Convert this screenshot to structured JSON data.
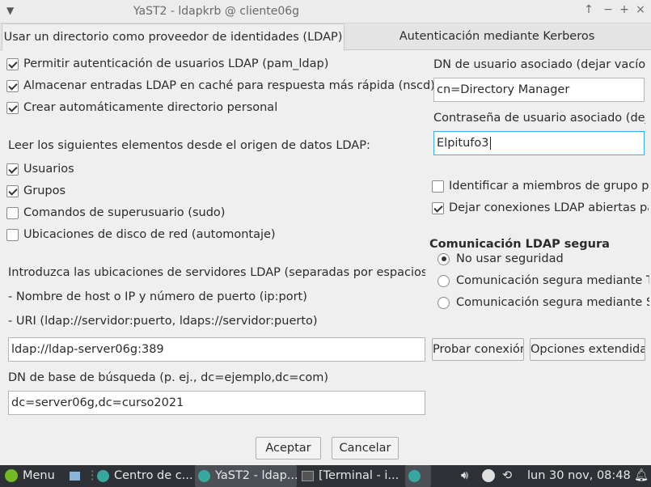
{
  "window": {
    "title": "YaST2 - ldapkrb @ cliente06g",
    "controls": [
      "↑",
      "−",
      "+",
      "×"
    ]
  },
  "tabs": [
    {
      "label": "Usar un directorio como proveedor de identidades (LDAP)"
    },
    {
      "label": "Autenticación mediante Kerberos"
    }
  ],
  "left": {
    "options": [
      {
        "label": "Permitir autenticación de usuarios LDAP (pam_ldap)",
        "checked": true
      },
      {
        "label": "Almacenar entradas LDAP en caché para respuesta más rápida (nscd)",
        "checked": true
      },
      {
        "label": "Crear automáticamente directorio personal",
        "checked": true
      }
    ],
    "read_heading": "Leer los siguientes elementos desde el origen de datos LDAP:",
    "sources": [
      {
        "label": "Usuarios",
        "checked": true
      },
      {
        "label": "Grupos",
        "checked": true
      },
      {
        "label": "Comandos de superusuario (sudo)",
        "checked": false
      },
      {
        "label": "Ubicaciones de disco de red (automontaje)",
        "checked": false
      }
    ],
    "servers_intro": "Introduzca las ubicaciones de servidores LDAP (separadas por espacios) e",
    "hint_host": "- Nombre de host o IP y número de puerto (ip:port)",
    "hint_uri": "- URI (ldap://servidor:puerto, ldaps://servidor:puerto)",
    "server_value": "ldap://ldap-server06g:389",
    "base_dn_label": "DN de base de búsqueda (p. ej., dc=ejemplo,dc=com)",
    "base_dn_value": "dc=server06g,dc=curso2021"
  },
  "right": {
    "bind_dn_label": "DN de usuario asociado (dejar vacío p",
    "bind_dn_value": "cn=Directory Manager",
    "bind_pw_label": "Contraseña de usuario asociado (deja",
    "bind_pw_value": "Elpitufo3",
    "group_members": {
      "label": "Identificar a miembros de grupo po",
      "checked": false
    },
    "keep_open": {
      "label": "Dejar conexiones LDAP abiertas pa",
      "checked": true
    },
    "secure_heading": "Comunicación LDAP segura",
    "security": [
      {
        "label": "No usar seguridad",
        "checked": true
      },
      {
        "label": "Comunicación segura mediante TL",
        "checked": false
      },
      {
        "label": "Comunicación segura mediante St",
        "checked": false
      }
    ],
    "test_button": "Probar conexión",
    "extended_button": "Opciones extendidas"
  },
  "footer": {
    "accept": "Aceptar",
    "cancel": "Cancelar"
  },
  "taskbar": {
    "menu": "Menu",
    "tasks": [
      {
        "label": "Centro de c...",
        "active": false
      },
      {
        "label": "YaST2 - ldap...",
        "active": true
      },
      {
        "label": "[Terminal - i...",
        "active": false
      }
    ],
    "clock": "lun 30 nov, 08:48"
  }
}
